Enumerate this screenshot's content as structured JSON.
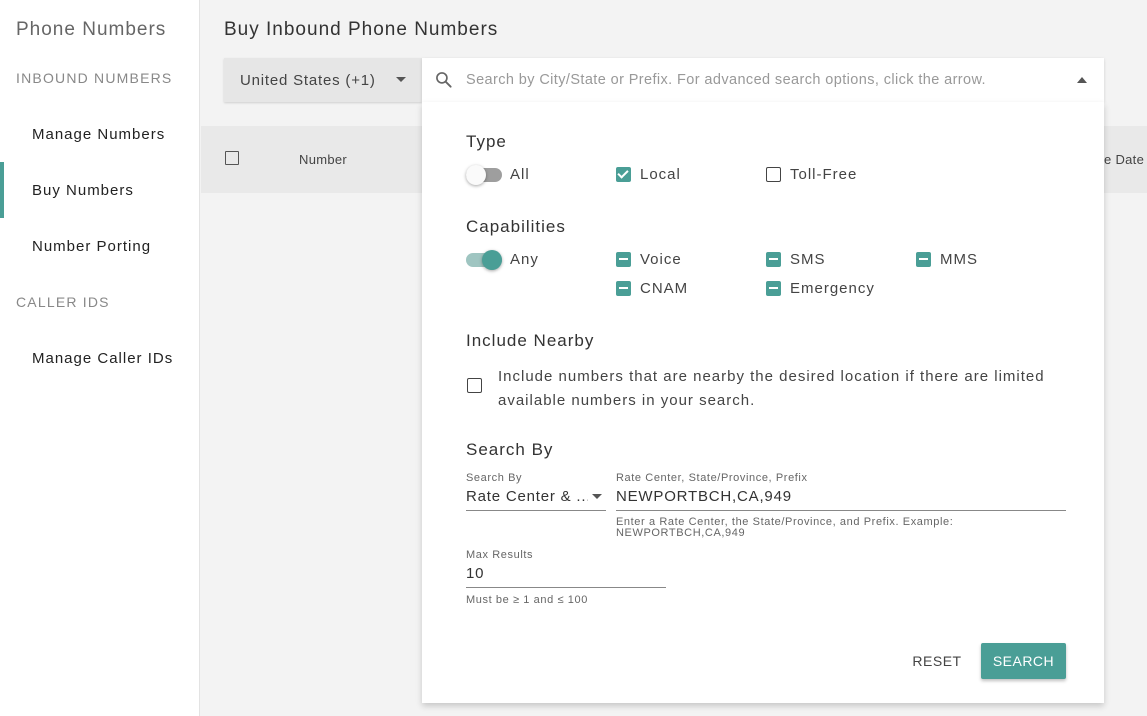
{
  "sidebar": {
    "title": "Phone Numbers",
    "section_inbound": "INBOUND NUMBERS",
    "items": [
      {
        "label": "Manage Numbers"
      },
      {
        "label": "Buy Numbers"
      },
      {
        "label": "Number Porting"
      }
    ],
    "section_caller": "CALLER IDS",
    "caller_items": [
      {
        "label": "Manage Caller IDs"
      }
    ]
  },
  "header": {
    "title": "Buy Inbound Phone Numbers",
    "country": "United States (+1)",
    "search_placeholder": "Search by City/State or Prefix. For advanced search options, click the arrow."
  },
  "table": {
    "col_number": "Number",
    "col_date": "e Date"
  },
  "panel": {
    "type": {
      "heading": "Type",
      "all_label": "All",
      "all_on": false,
      "local_label": "Local",
      "local_checked": true,
      "tollfree_label": "Toll-Free",
      "tollfree_checked": false
    },
    "capabilities": {
      "heading": "Capabilities",
      "any_label": "Any",
      "any_on": true,
      "voice": "Voice",
      "sms": "SMS",
      "mms": "MMS",
      "cnam": "CNAM",
      "emergency": "Emergency"
    },
    "nearby": {
      "heading": "Include Nearby",
      "line1": "Include numbers that are nearby the desired location if there are limited",
      "line2": "available numbers in your search.",
      "checked": false
    },
    "search_by": {
      "heading": "Search By",
      "select_label": "Search By",
      "select_value": "Rate Center & ...",
      "field_label": "Rate Center, State/Province, Prefix",
      "field_value": "NEWPORTBCH,CA,949",
      "hint_line1": "Enter a Rate Center, the State/Province, and Prefix. Example:",
      "hint_line2": "NEWPORTBCH,CA,949",
      "max_label": "Max Results",
      "max_value": "10",
      "max_hint": "Must be ≥ 1 and ≤ 100"
    },
    "buttons": {
      "reset": "RESET",
      "search": "SEARCH"
    }
  },
  "colors": {
    "accent": "#4a9e96"
  }
}
